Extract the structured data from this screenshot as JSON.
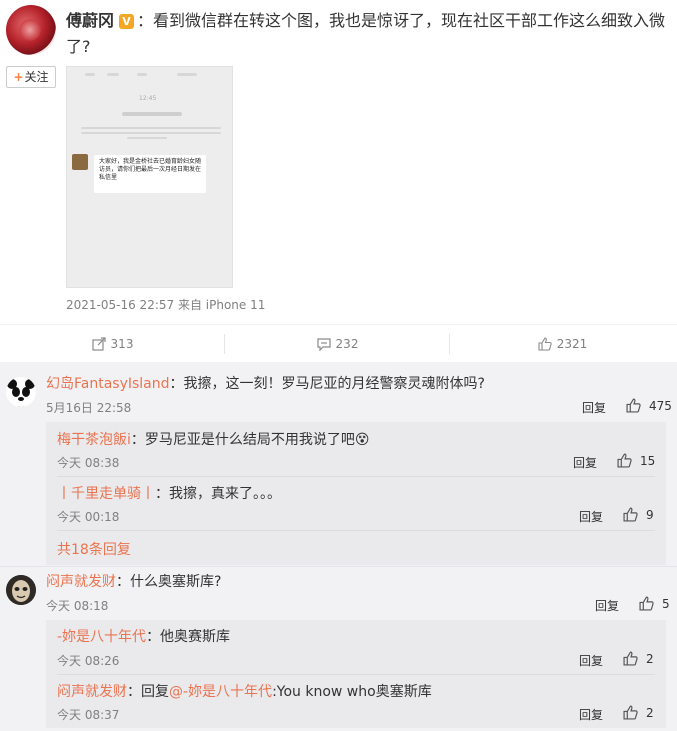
{
  "post": {
    "author": "傅蔚冈",
    "verified_badge": "V",
    "separator": "：",
    "text": "看到微信群在转这个图，我也是惊讶了，现在社区干部工作这么细致入微了?",
    "follow_label": "关注",
    "follow_plus": "+",
    "image": {
      "time": "12:45",
      "bubble_text": "大家好，我是金桥社去已婚育龄妇女随访员，请你们把最后一次月经日期发在私信里"
    },
    "meta": "2021-05-16 22:57 来自 iPhone 11"
  },
  "actions": {
    "repost_count": "313",
    "comment_count": "232",
    "like_count": "2321"
  },
  "comments": [
    {
      "name": "幻岛FantasyIsland",
      "text": "：我擦，这一刻！罗马尼亚的月经警察灵魂附体吗?",
      "time": "5月16日 22:58",
      "reply_label": "回复",
      "likes": "475",
      "replies": [
        {
          "name": "梅干茶泡飯i",
          "text": "：罗马尼亚是什么结局不用我说了吧",
          "emoji": "😵",
          "time": "今天 08:38",
          "reply_label": "回复",
          "likes": "15"
        },
        {
          "name": "丨千里走单骑丨",
          "text": "：我擦，真来了。。。",
          "time": "今天 00:18",
          "reply_label": "回复",
          "likes": "9"
        }
      ],
      "more": "共18条回复"
    },
    {
      "name": "闷声就发财",
      "text": "：什么奥塞斯库?",
      "time": "今天 08:18",
      "reply_label": "回复",
      "likes": "5",
      "replies": [
        {
          "name": "-妳是八十年代",
          "text": "：他奥赛斯库",
          "time": "今天 08:26",
          "reply_label": "回复",
          "likes": "2"
        },
        {
          "name": "闷声就发财",
          "text": "：回复",
          "mention": "@-妳是八十年代",
          "tail": ":You know who奥塞斯库",
          "time": "今天 08:37",
          "reply_label": "回复",
          "likes": "2"
        }
      ]
    }
  ],
  "colors": {
    "name_accent": "#eb7350",
    "comment_bg": "#f2f2f5",
    "sub_bg": "#eaeaec"
  }
}
